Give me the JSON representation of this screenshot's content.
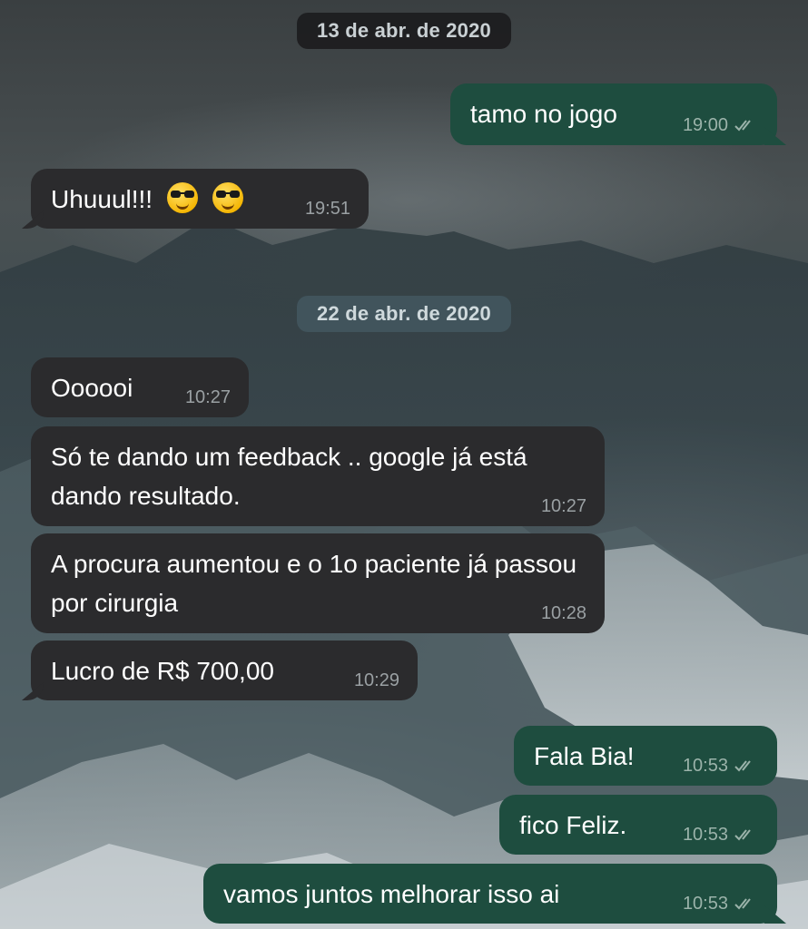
{
  "dates": [
    "13 de abr. de 2020",
    "22 de abr. de 2020"
  ],
  "messages": [
    {
      "text": "tamo no jogo",
      "time": "19:00",
      "dir": "out",
      "read": true
    },
    {
      "text": "Uhuuul!!!",
      "emoji": [
        "smiling-face-with-sunglasses",
        "smiling-face-with-sunglasses"
      ],
      "time": "19:51",
      "dir": "in"
    },
    {
      "text": "Oooooi",
      "time": "10:27",
      "dir": "in"
    },
    {
      "text": "Só te dando um feedback ..  google já está dando resultado.",
      "time": "10:27",
      "dir": "in"
    },
    {
      "text": "A procura aumentou e o 1o paciente já passou por cirurgia",
      "time": "10:28",
      "dir": "in"
    },
    {
      "text": "Lucro de R$ 700,00",
      "time": "10:29",
      "dir": "in"
    },
    {
      "text": "Fala Bia!",
      "time": "10:53",
      "dir": "out",
      "read": true
    },
    {
      "text": "fico Feliz.",
      "time": "10:53",
      "dir": "out",
      "read": true
    },
    {
      "text": "vamos juntos melhorar isso ai",
      "time": "10:53",
      "dir": "out",
      "read": true
    }
  ],
  "colors": {
    "incoming_bubble": "#2b2b2d",
    "outgoing_bubble": "#1e4d3f",
    "text": "#ffffff",
    "timestamp": "#9aa0a3"
  }
}
